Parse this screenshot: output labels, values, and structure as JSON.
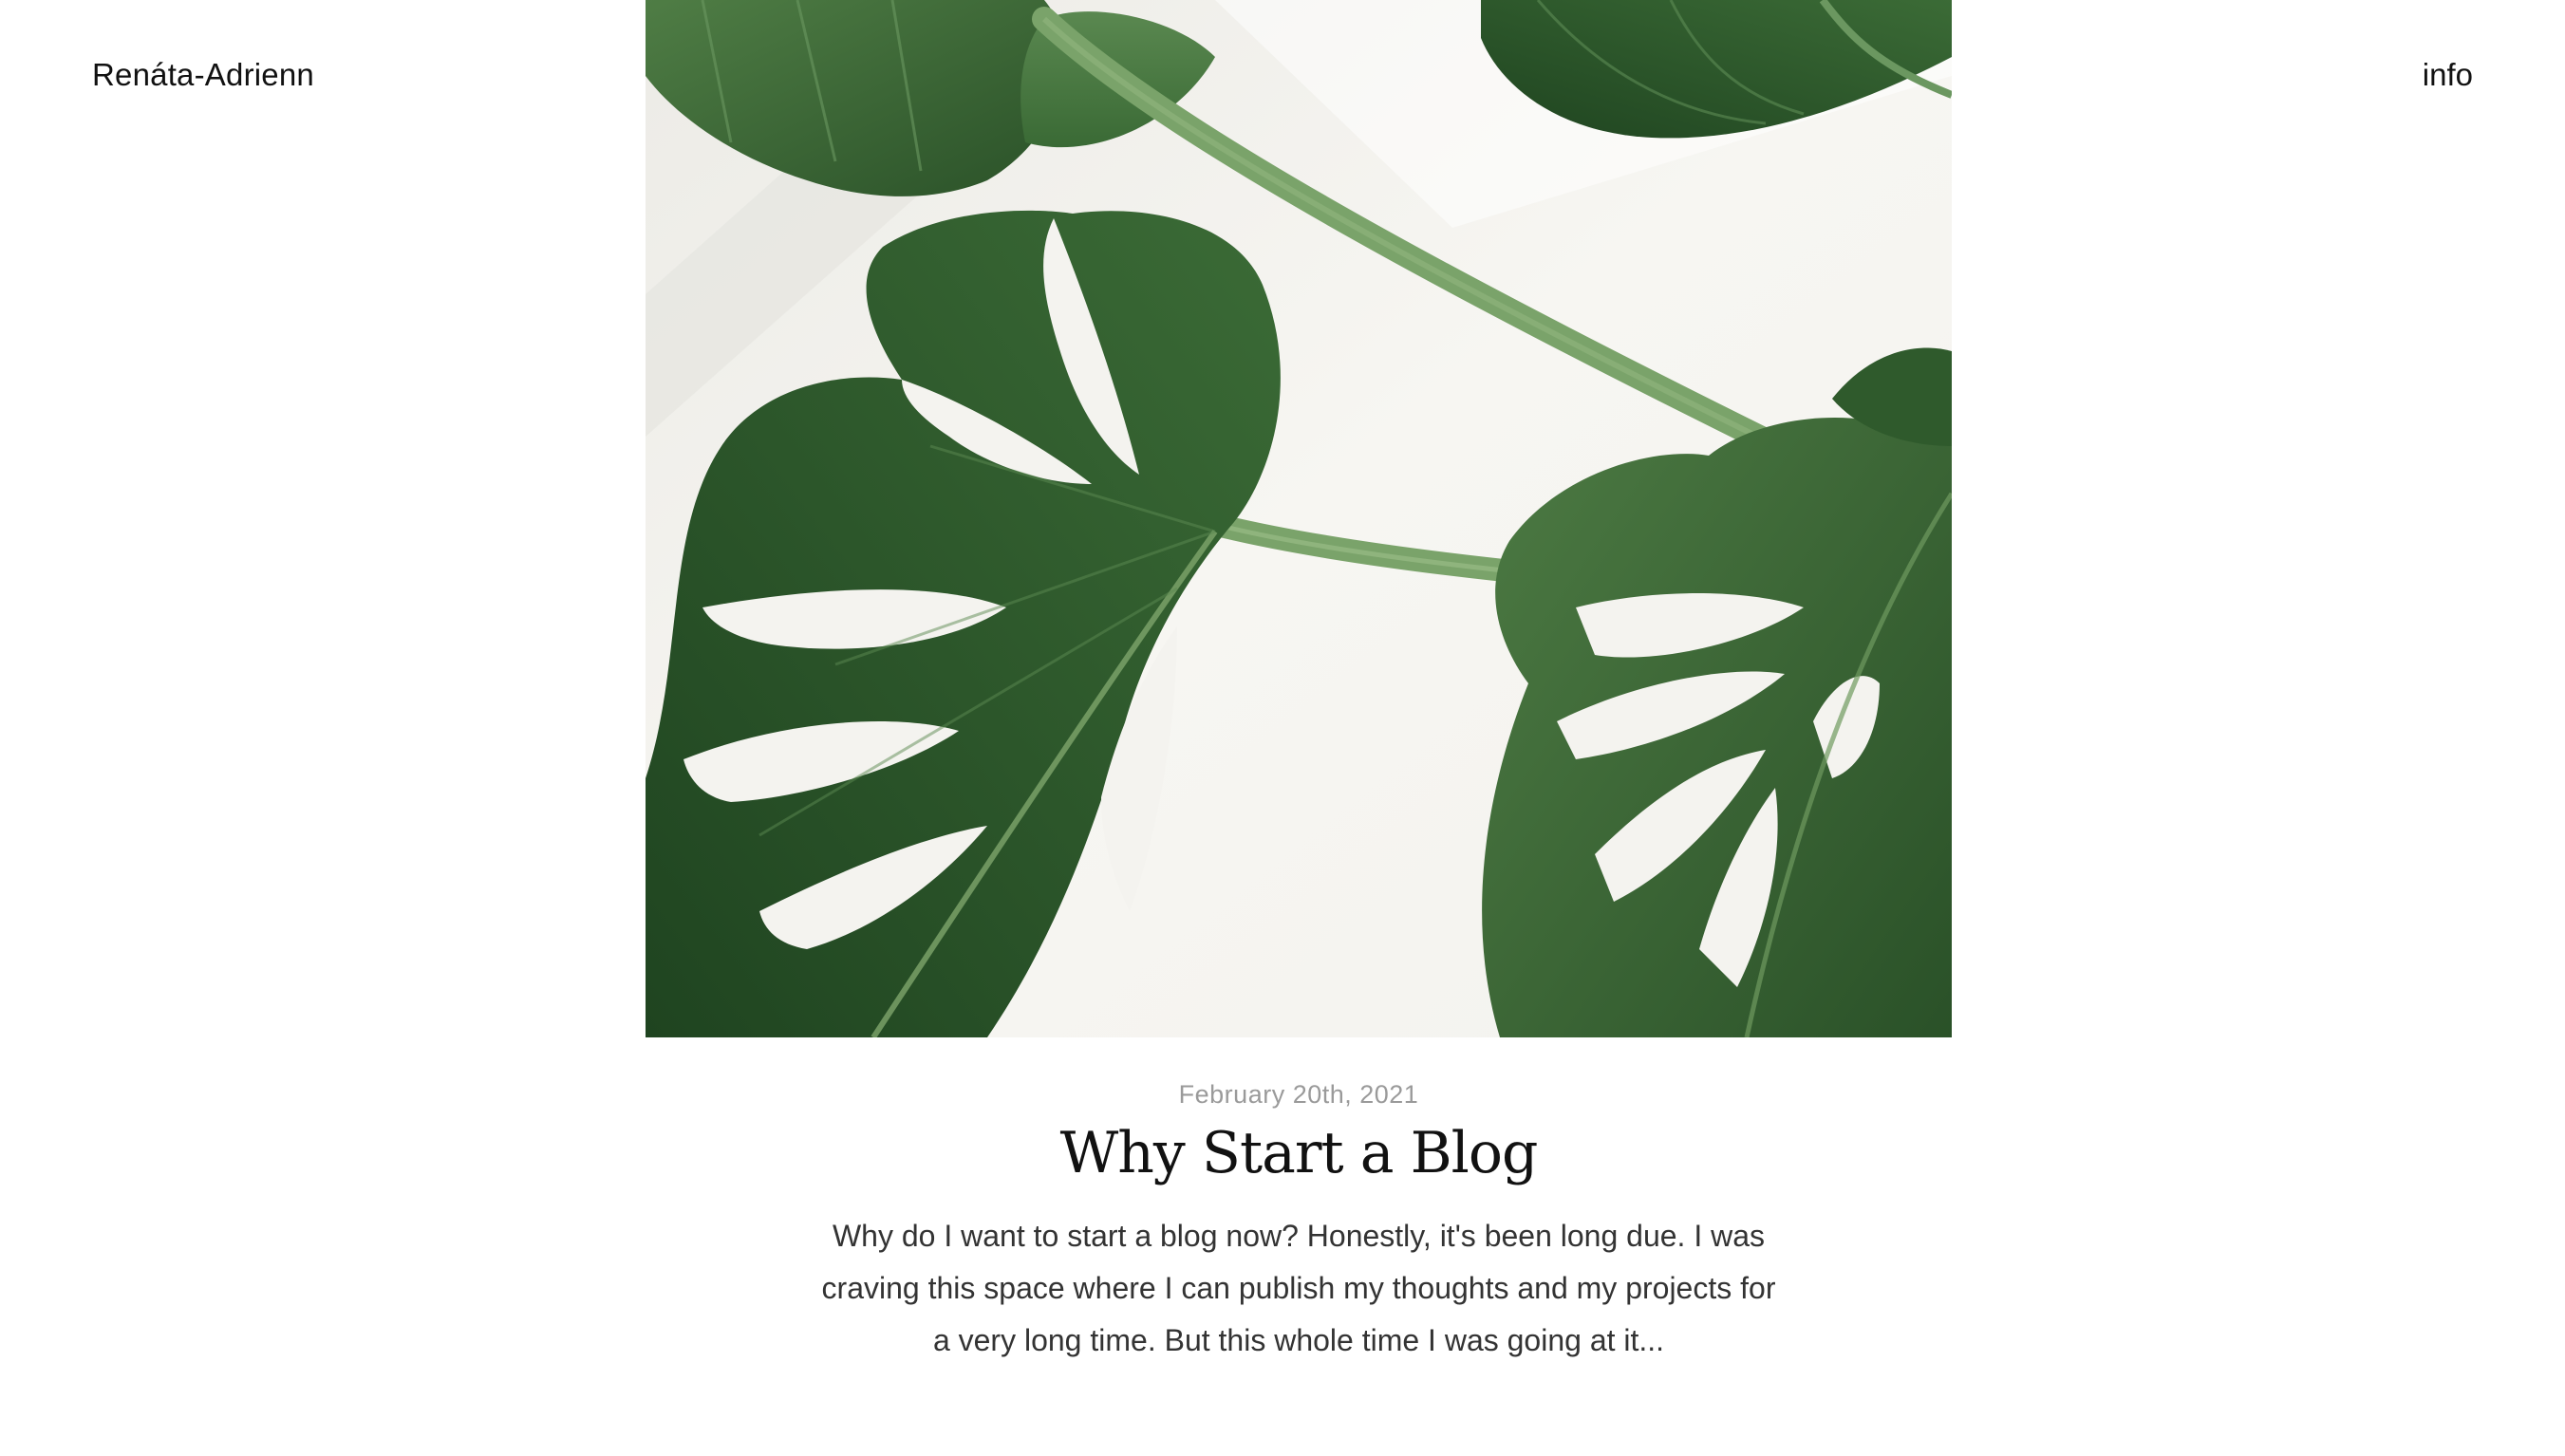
{
  "header": {
    "site_name": "Renáta-Adrienn",
    "nav_info": "info"
  },
  "post": {
    "image_icon": "monstera-leaves-photo",
    "date": "February 20th, 2021",
    "title": "Why Start a Blog",
    "excerpt": "Why do I want to start a blog now? Honestly, it's been long due. I was craving this space where I can publish my thoughts and my projects for a very long time. But this whole time I was going at it..."
  },
  "colors": {
    "background": "#ffffff",
    "text": "#111111",
    "date": "#9a9a9a",
    "excerpt": "#333333",
    "leaf_dark": "#2f5a2c",
    "leaf_mid": "#4a7a42",
    "stem": "#7aa36a",
    "photo_bg": "#f4f3ef"
  }
}
